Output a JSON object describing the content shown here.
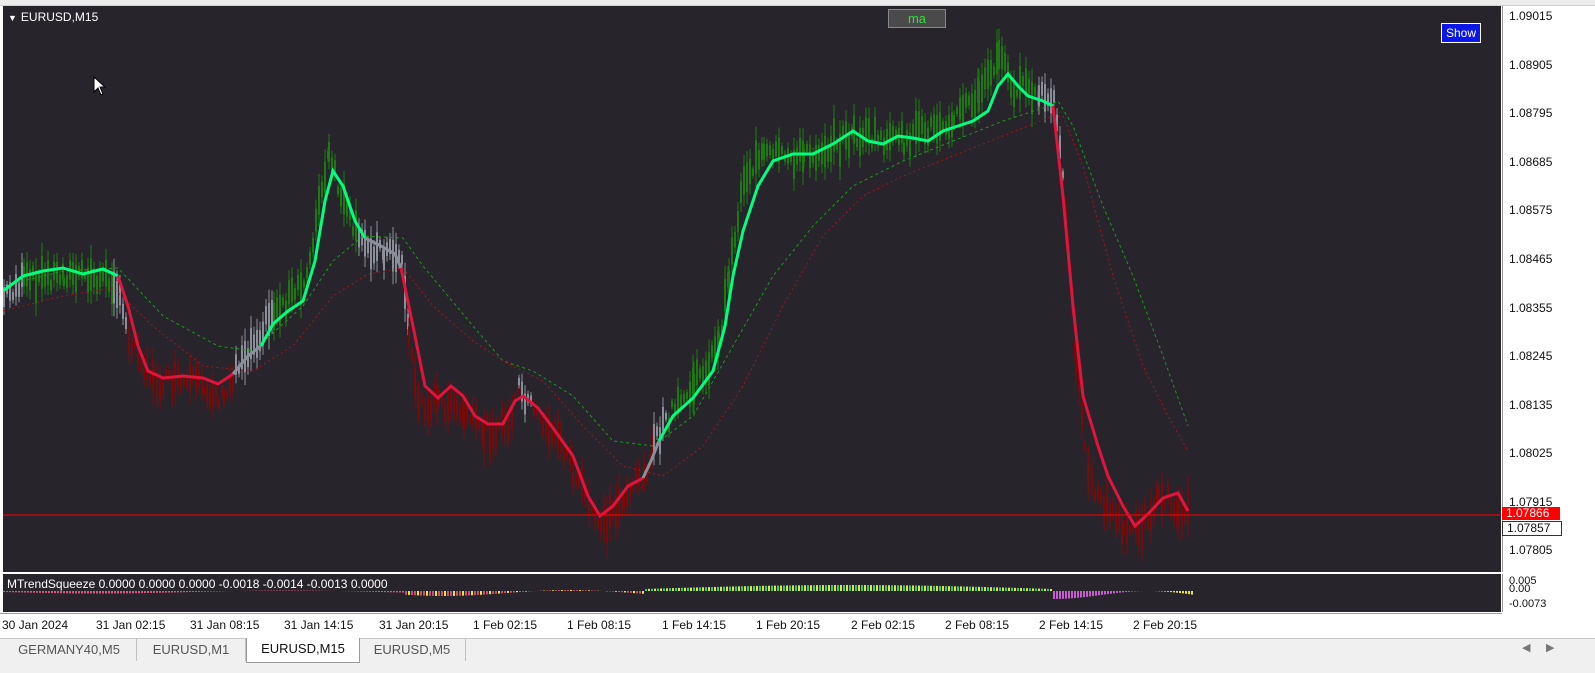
{
  "symbol_title": "EURUSD,M15",
  "ma_button": "ma",
  "show_button": "Show",
  "indicator_label": "MTrendSqueeze 0.0000 0.0000 0.0000 -0.0018 -0.0014 -0.0013 0.0000",
  "price_axis": {
    "ticks": [
      "1.09015",
      "1.08905",
      "1.08795",
      "1.08685",
      "1.08575",
      "1.08465",
      "1.08355",
      "1.08245",
      "1.08135",
      "1.08025",
      "1.07915",
      "1.07805"
    ]
  },
  "bid_price": "1.07866",
  "ask_price": "1.07857",
  "indicator_axis": {
    "top": "0.005",
    "mid": "0.00",
    "bottom": "-0.0073"
  },
  "time_axis": {
    "labels": [
      "30 Jan 2024",
      "31 Jan 02:15",
      "31 Jan 08:15",
      "31 Jan 14:15",
      "31 Jan 20:15",
      "1 Feb 02:15",
      "1 Feb 08:15",
      "1 Feb 14:15",
      "1 Feb 20:15",
      "2 Feb 02:15",
      "2 Feb 08:15",
      "2 Feb 14:15",
      "2 Feb 20:15"
    ]
  },
  "tabs": [
    {
      "label": "GERMANY40,M5",
      "active": false
    },
    {
      "label": "EURUSD,M1",
      "active": false
    },
    {
      "label": "EURUSD,M15",
      "active": true
    },
    {
      "label": "EURUSD,M5",
      "active": false
    }
  ],
  "colors": {
    "background": "#28242b",
    "bull_line": "#00ff7f",
    "bear_line": "#e0143c",
    "neutral": "#8a8f99",
    "bull_candle": "#1d7a10",
    "bear_candle": "#7a0a0a",
    "bid_line": "#ff0000"
  },
  "icons": [
    "dropdown-triangle-icon",
    "mouse-cursor-icon",
    "scroll-left-icon",
    "scroll-right-icon"
  ]
}
